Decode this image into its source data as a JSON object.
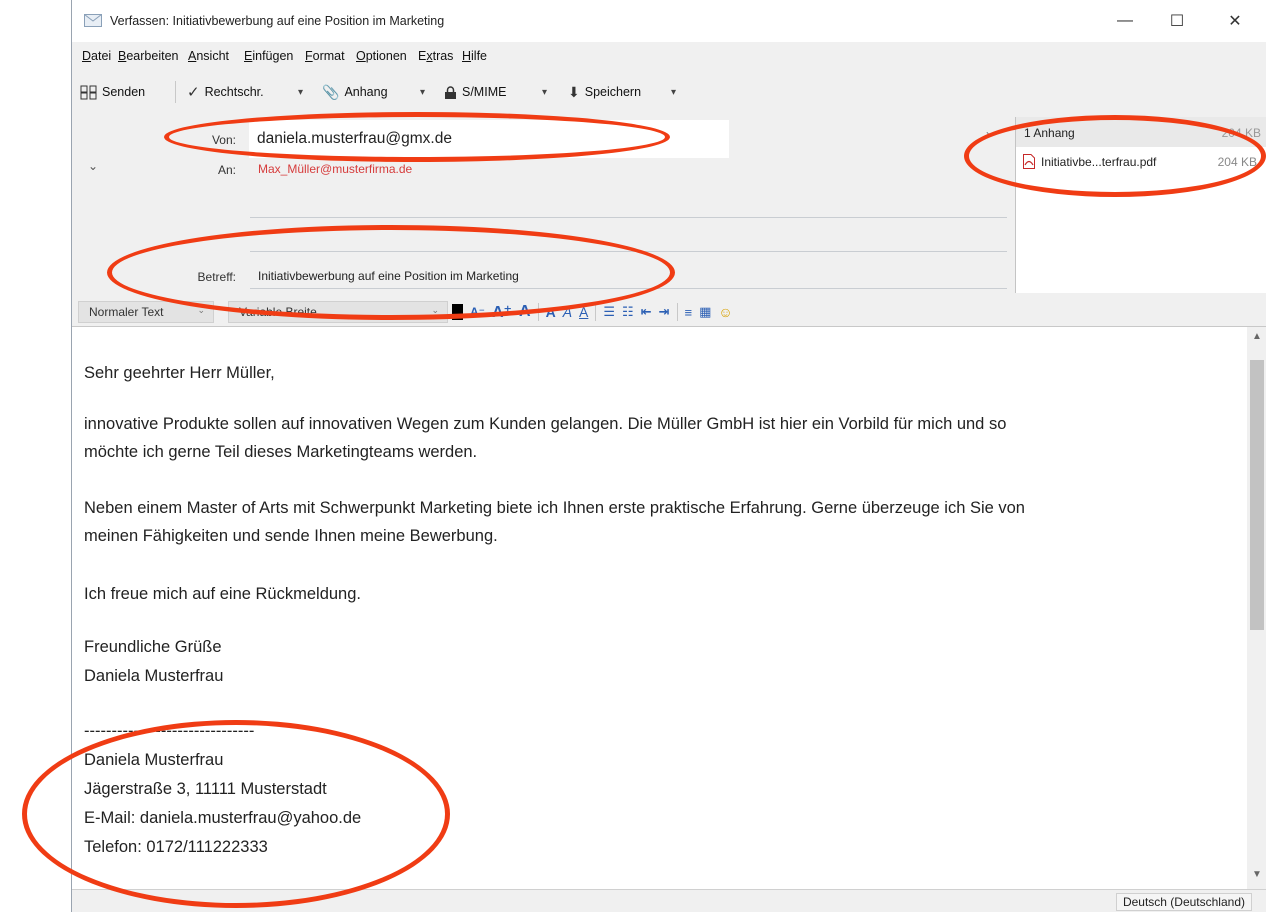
{
  "window": {
    "title": "Verfassen: Initiativbewerbung auf eine Position im Marketing",
    "minimize": "—",
    "maximize": "☐",
    "close": "✕"
  },
  "menu": [
    {
      "u": "D",
      "rest": "atei"
    },
    {
      "u": "B",
      "rest": "earbeiten"
    },
    {
      "u": "A",
      "rest": "nsicht"
    },
    {
      "u": "E",
      "rest": "infügen"
    },
    {
      "u": "F",
      "rest": "ormat"
    },
    {
      "u": "O",
      "rest": "ptionen"
    },
    {
      "pre": "E",
      "u": "x",
      "rest": "tras"
    },
    {
      "u": "H",
      "rest": "ilfe"
    }
  ],
  "toolbar": {
    "send": "Senden",
    "spell": "Rechtschr.",
    "attach": "Anhang",
    "smime": "S/MIME",
    "save": "Speichern",
    "drop": "▾"
  },
  "header": {
    "from_label": "Von:",
    "from_value": "daniela.musterfrau@gmx.de",
    "to_label": "An:",
    "to_value": "Max_Müller@musterfirma.de",
    "subject_label": "Betreff:",
    "subject_value": "Initiativbewerbung auf eine Position im Marketing",
    "toggle": "⌄",
    "split": "›"
  },
  "attachments": {
    "count_label": "1 Anhang",
    "total_size": "204 KB",
    "items": [
      {
        "name": "Initiativbe...terfrau.pdf",
        "size": "204 KB"
      }
    ]
  },
  "format": {
    "paragraph_style": "Normaler Text",
    "font": "Variable Breite",
    "chev": "⌄"
  },
  "body": {
    "greeting": "Sehr geehrter Herr Müller,",
    "p1_line1": "innovative Produkte sollen auf innovativen Wegen zum Kunden gelangen. Die Müller GmbH ist hier ein Vorbild für mich und so",
    "p1_line2": "möchte ich gerne Teil dieses Marketingteams werden.",
    "p2_line1": "Neben einem Master of Arts mit Schwerpunkt Marketing biete ich Ihnen erste praktische Erfahrung. Gerne überzeuge ich Sie von",
    "p2_line2": "meinen Fähigkeiten und sende Ihnen meine Bewerbung.",
    "p3": "Ich freue mich auf eine Rückmeldung.",
    "closing": "Freundliche Grüße",
    "name": "Daniela Musterfrau",
    "sig_sep": "-------------------------------",
    "sig_name": "Daniela Musterfrau",
    "sig_address": "Jägerstraße 3, 11111 Musterstadt",
    "sig_email": "E-Mail: daniela.musterfrau@yahoo.de",
    "sig_phone": "Telefon: 0172/111222333"
  },
  "status": {
    "language": "Deutsch (Deutschland)"
  },
  "colors": {
    "annotation": "#f03c14",
    "recipient": "#d63c3c",
    "toolbar_icon": "#2b5fb4"
  }
}
